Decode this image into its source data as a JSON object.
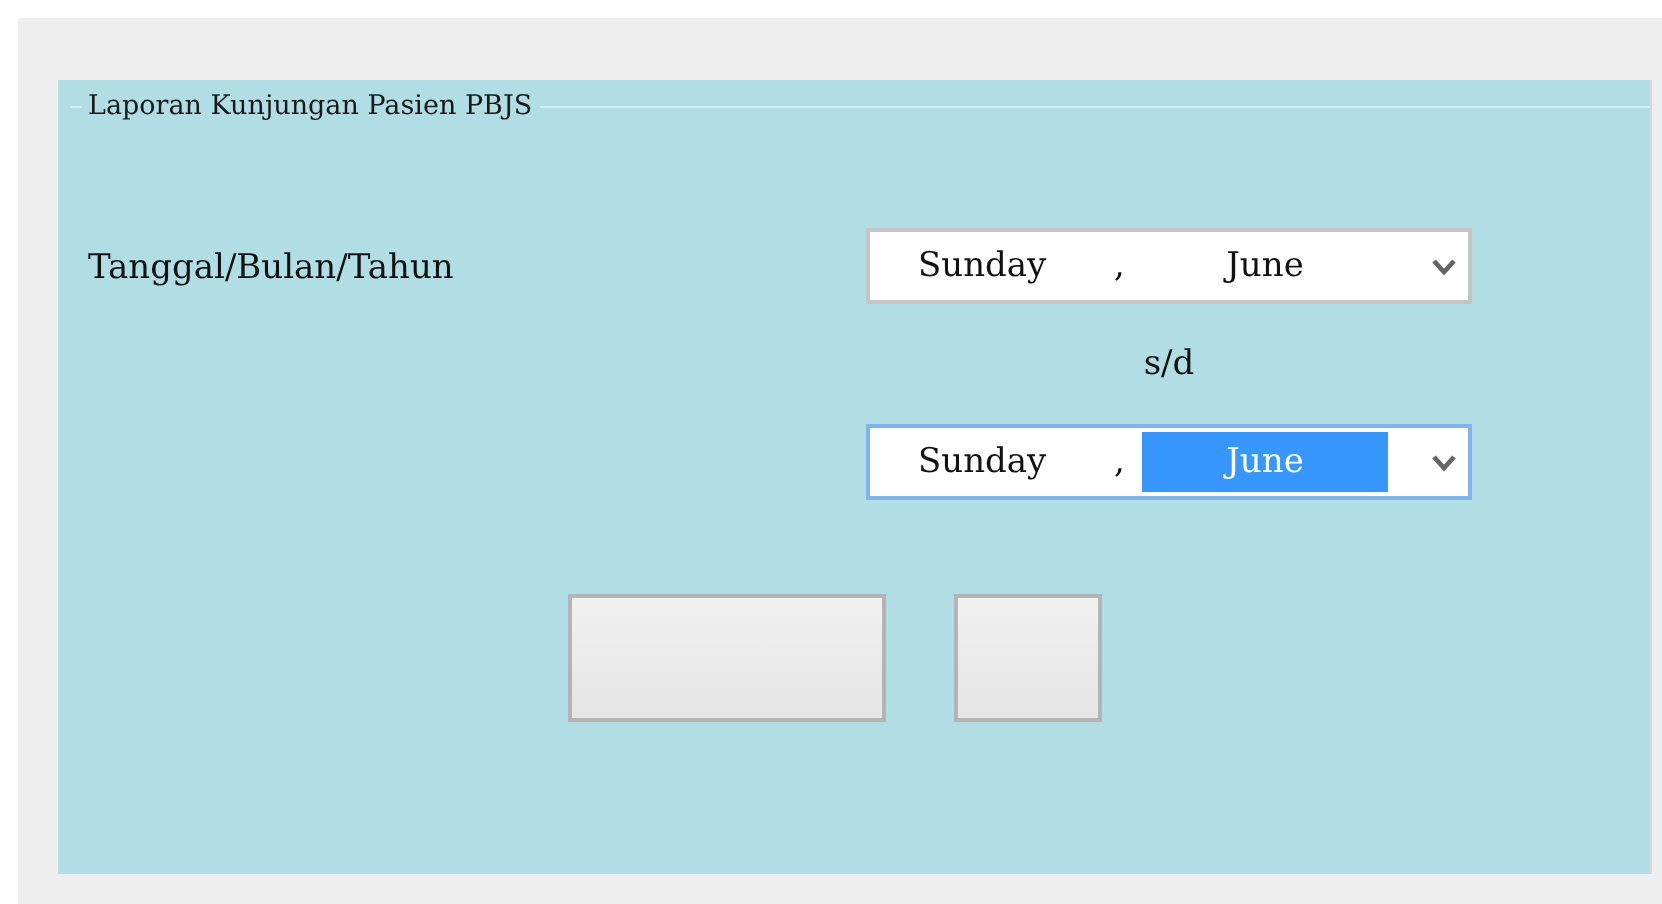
{
  "panel": {
    "legend": "Laporan Kunjungan Pasien PBJS"
  },
  "date_label": "Tanggal/Bulan/Tahun",
  "date_pickers": [
    {
      "day": "Sunday",
      "separator": ",",
      "month": "June",
      "focused": false,
      "month_selected": false
    },
    {
      "day": "Sunday",
      "separator": ",",
      "month": "June",
      "focused": true,
      "month_selected": true
    }
  ],
  "range_separator": "s/d",
  "buttons": [
    {
      "kind": "wide"
    },
    {
      "kind": "narrow"
    }
  ]
}
